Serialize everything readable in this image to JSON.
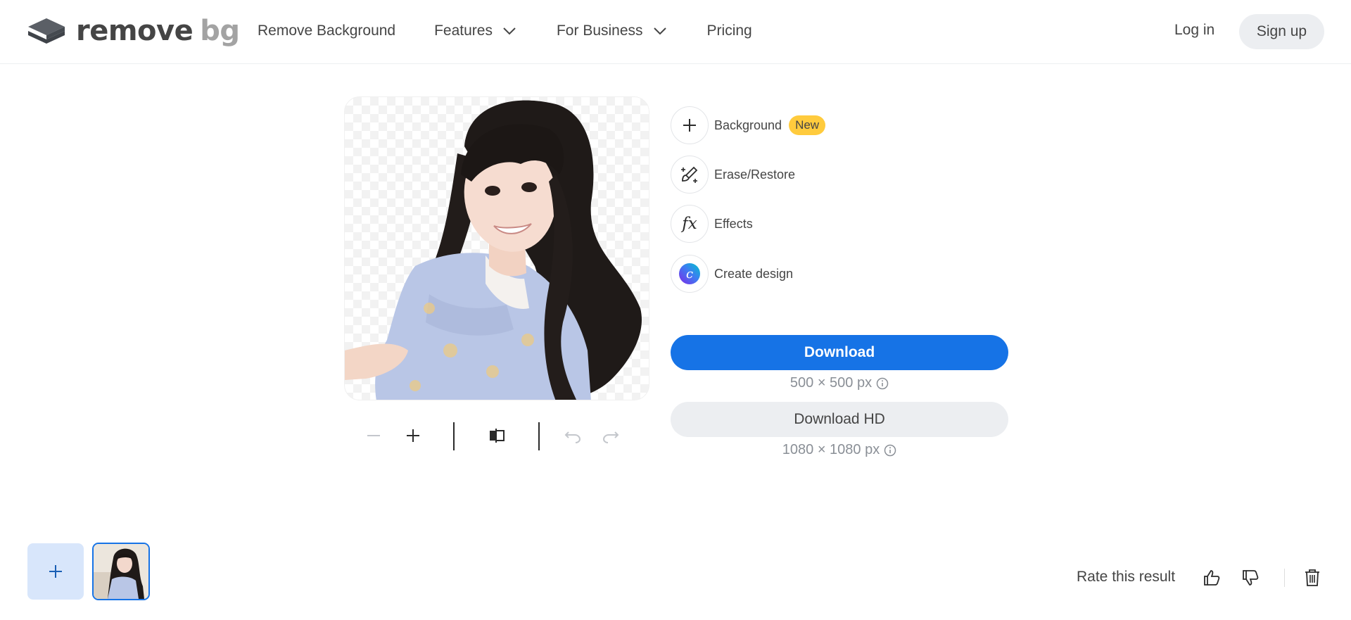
{
  "brand": {
    "name_part1": "remove",
    "name_part2": "bg"
  },
  "nav": {
    "items": [
      {
        "label": "Remove Background",
        "has_dropdown": false
      },
      {
        "label": "Features",
        "has_dropdown": true
      },
      {
        "label": "For Business",
        "has_dropdown": true
      },
      {
        "label": "Pricing",
        "has_dropdown": false
      }
    ],
    "login_label": "Log in",
    "signup_label": "Sign up"
  },
  "editor": {
    "options": [
      {
        "label": "Background",
        "icon": "plus-icon",
        "badge": "New"
      },
      {
        "label": "Erase/Restore",
        "icon": "brush-icon"
      },
      {
        "label": "Effects",
        "icon": "fx-icon"
      },
      {
        "label": "Create design",
        "icon": "canva-icon"
      }
    ],
    "download": {
      "label": "Download",
      "dimensions": "500 × 500 px"
    },
    "download_hd": {
      "label": "Download HD",
      "dimensions": "1080 × 1080 px"
    },
    "toolbar_icons": [
      "zoom-out-icon",
      "zoom-in-icon",
      "compare-icon",
      "undo-icon",
      "redo-icon"
    ]
  },
  "footer": {
    "rate_label": "Rate this result"
  },
  "colors": {
    "accent": "#1673e6",
    "badge": "#ffcb3d",
    "text": "#454545",
    "muted": "#8a8f96"
  }
}
